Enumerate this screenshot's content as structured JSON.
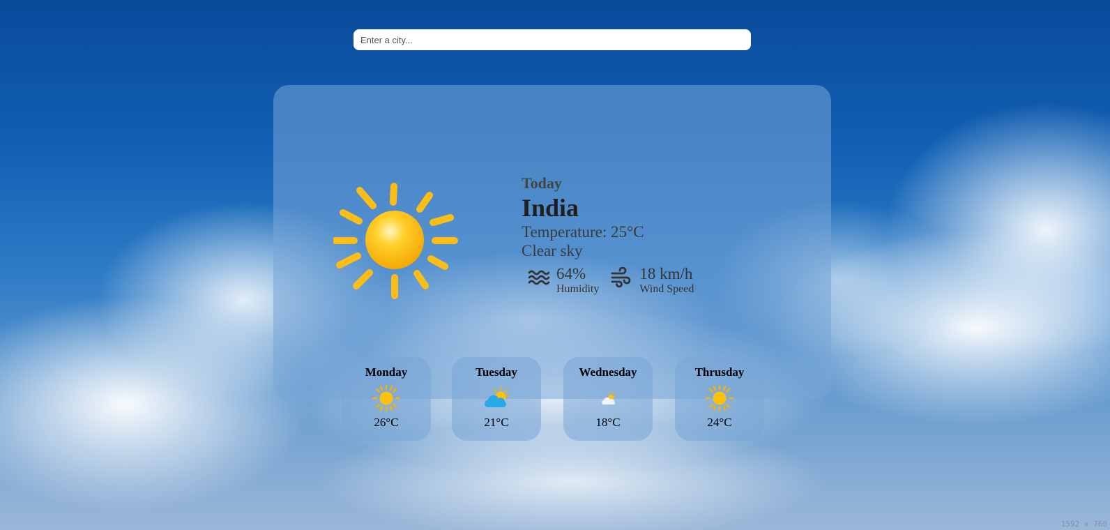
{
  "search": {
    "placeholder": "Enter a city..."
  },
  "current": {
    "label": "Today",
    "city": "India",
    "temperature_text": "Temperature: 25°C",
    "condition": "Clear sky",
    "icon": "sun-icon",
    "humidity": {
      "value": "64%",
      "label": "Humidity",
      "icon": "humidity-waves-icon"
    },
    "wind": {
      "value": "18 km/h",
      "label": "Wind Speed",
      "icon": "wind-icon"
    }
  },
  "forecast": [
    {
      "day": "Monday",
      "temp": "26°C",
      "icon": "sun-icon"
    },
    {
      "day": "Tuesday",
      "temp": "21°C",
      "icon": "sun-behind-cloud-icon"
    },
    {
      "day": "Wednesday",
      "temp": "18°C",
      "icon": "sun-behind-small-cloud-icon"
    },
    {
      "day": "Thrusday",
      "temp": "24°C",
      "icon": "sun-icon"
    }
  ],
  "corner_note": "1592 x 760",
  "colors": {
    "sun": "#ffc107",
    "card": "#78a5d7",
    "cloud_blue": "#29a9e8"
  }
}
